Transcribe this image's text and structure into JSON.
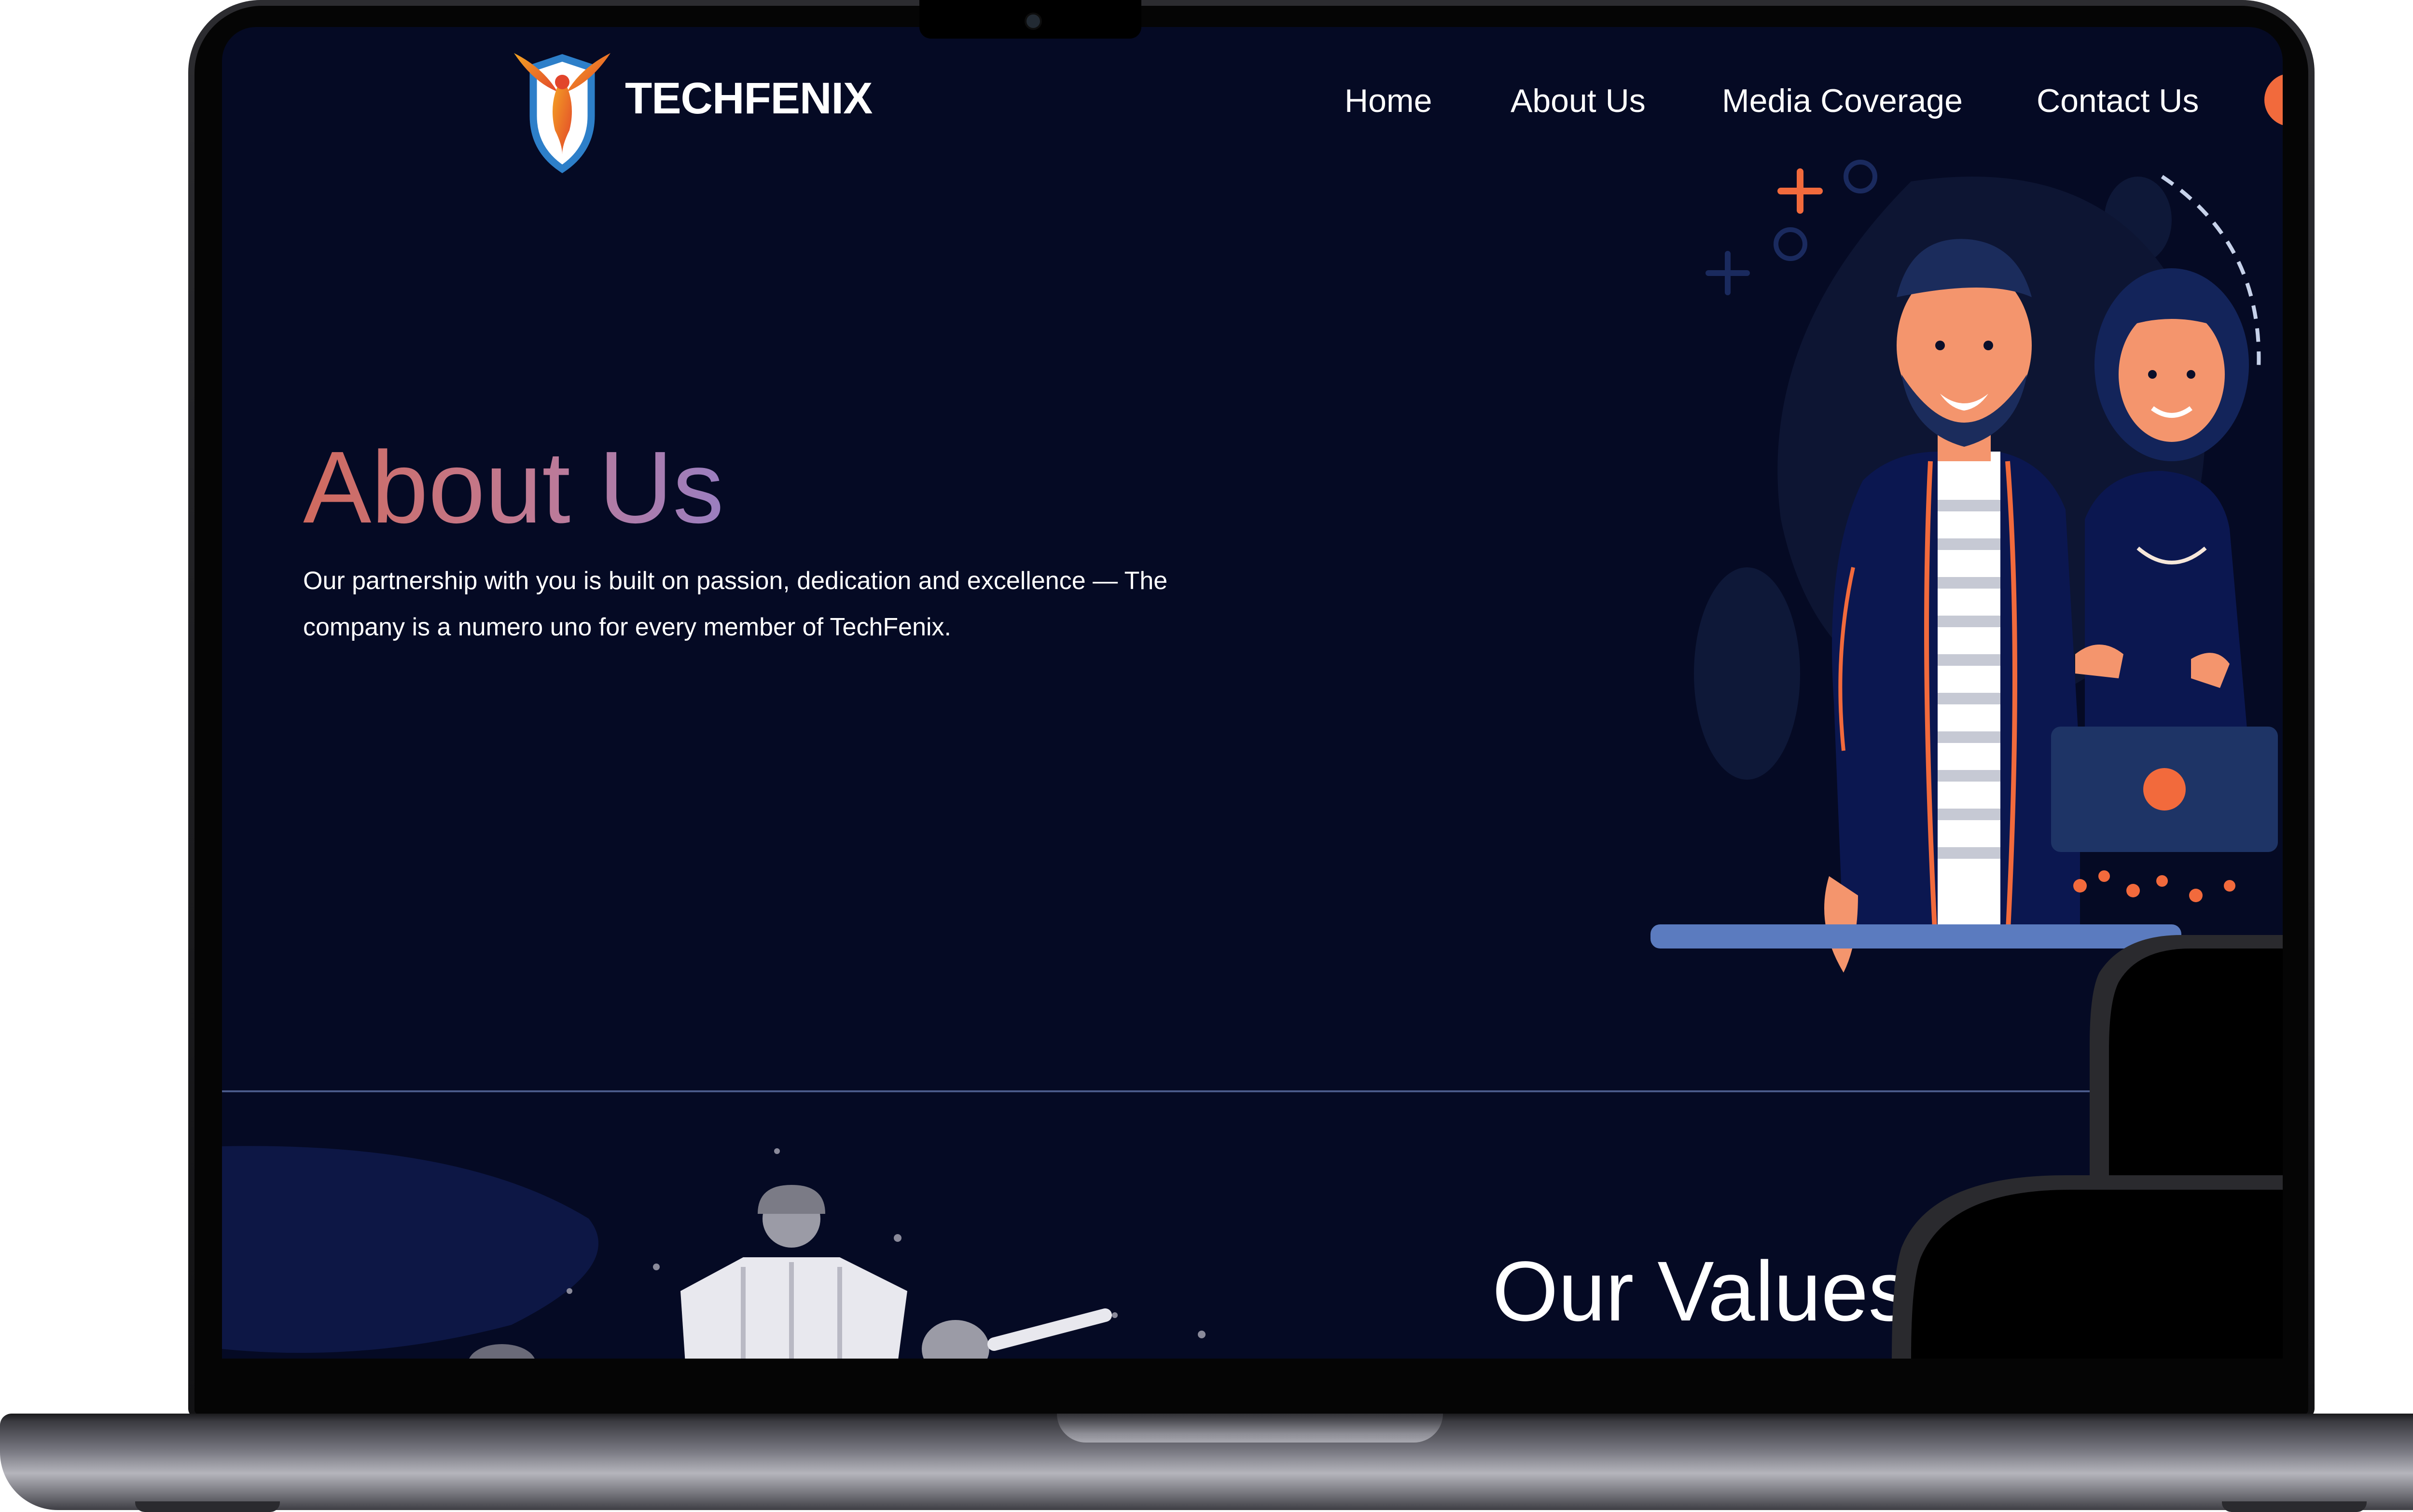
{
  "site": {
    "brand": "TECHFENIX",
    "nav": [
      {
        "label": "Home"
      },
      {
        "label": "About Us"
      },
      {
        "label": "Media Coverage"
      },
      {
        "label": "Contact Us"
      }
    ]
  },
  "hero": {
    "title": "About Us",
    "description": "Our partnership with you is built on passion, dedication and excellence — The company is a numero uno for every member of TechFenix."
  },
  "values": {
    "title": "Our Values"
  },
  "colors": {
    "background": "#050a24",
    "accent_orange": "#f26a3c",
    "title_gradient_start": "#d06a5e",
    "title_gradient_end": "#9a7ec0",
    "device_frame": "#1c1c1f"
  },
  "icons": {
    "logo": "phoenix-shield-icon"
  }
}
